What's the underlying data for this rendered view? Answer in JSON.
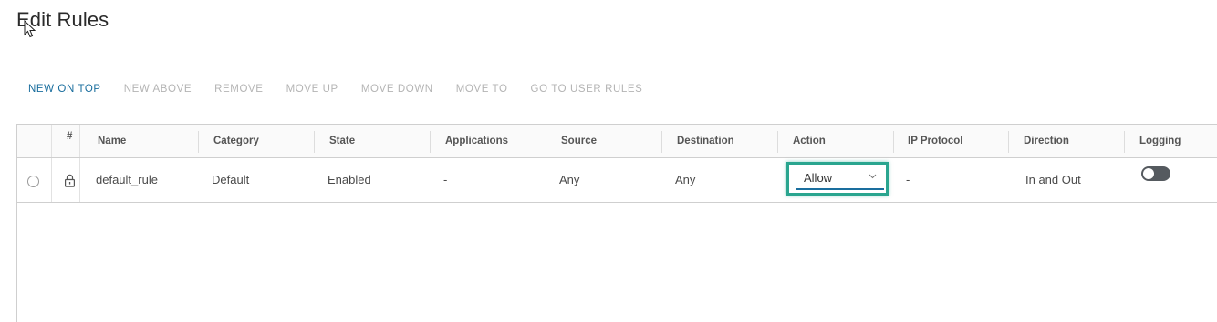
{
  "page": {
    "title": "Edit Rules"
  },
  "toolbar": {
    "buttons": [
      {
        "label": "NEW ON TOP",
        "enabled": true
      },
      {
        "label": "NEW ABOVE",
        "enabled": false
      },
      {
        "label": "REMOVE",
        "enabled": false
      },
      {
        "label": "MOVE UP",
        "enabled": false
      },
      {
        "label": "MOVE DOWN",
        "enabled": false
      },
      {
        "label": "MOVE TO",
        "enabled": false
      },
      {
        "label": "GO TO USER RULES",
        "enabled": false
      }
    ]
  },
  "grid": {
    "columns": {
      "number": "#",
      "name": "Name",
      "category": "Category",
      "state": "State",
      "applications": "Applications",
      "source": "Source",
      "destination": "Destination",
      "action": "Action",
      "ip_protocol": "IP Protocol",
      "direction": "Direction",
      "logging": "Logging"
    },
    "rows": [
      {
        "locked": true,
        "name": "default_rule",
        "category": "Default",
        "state": "Enabled",
        "applications": "-",
        "source": "Any",
        "destination": "Any",
        "action": "Allow",
        "ip_protocol": "-",
        "direction": "In and Out",
        "logging": false
      }
    ]
  },
  "colors": {
    "accent": "#1a6e9e",
    "focus_highlight": "#2aa58f",
    "disabled_text": "#b4b4b4",
    "toggle_off": "#555a5f"
  },
  "icons": {
    "row_select": "radio-icon",
    "locked": "lock-icon",
    "dropdown": "chevron-down-icon",
    "pointer": "mouse-cursor-icon"
  }
}
